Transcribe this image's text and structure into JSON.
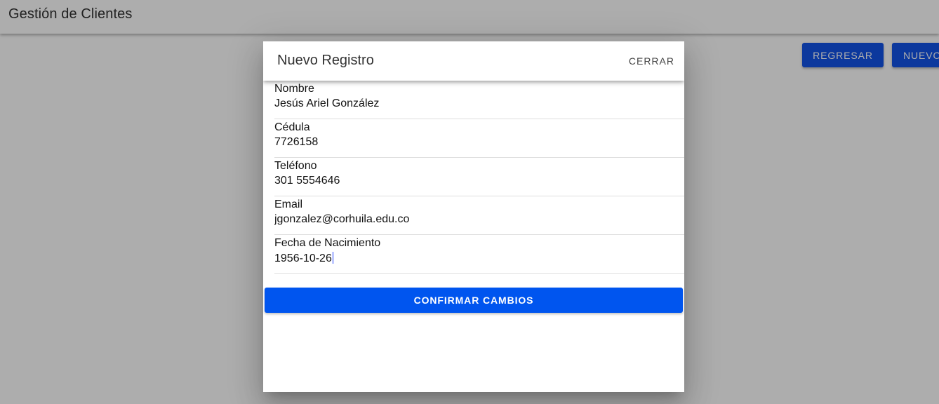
{
  "app": {
    "title": "Gestión de Clientes",
    "actions": {
      "back_label": "REGRESAR",
      "new_label": "NUEVO"
    }
  },
  "dialog": {
    "title": "Nuevo Registro",
    "close_label": "CERRAR",
    "fields": [
      {
        "label": "Nombre",
        "value": "Jesús Ariel González"
      },
      {
        "label": "Cédula",
        "value": "7726158"
      },
      {
        "label": "Teléfono",
        "value": "301 5554646"
      },
      {
        "label": "Email",
        "value": "jgonzalez@corhuila.edu.co"
      },
      {
        "label": "Fecha de Nacimiento",
        "value": "1956-10-26"
      }
    ],
    "confirm_label": "CONFIRMAR CAMBIOS"
  },
  "colors": {
    "primary": "#0047e6",
    "confirm": "#0055ef",
    "scrim": "#212121"
  }
}
